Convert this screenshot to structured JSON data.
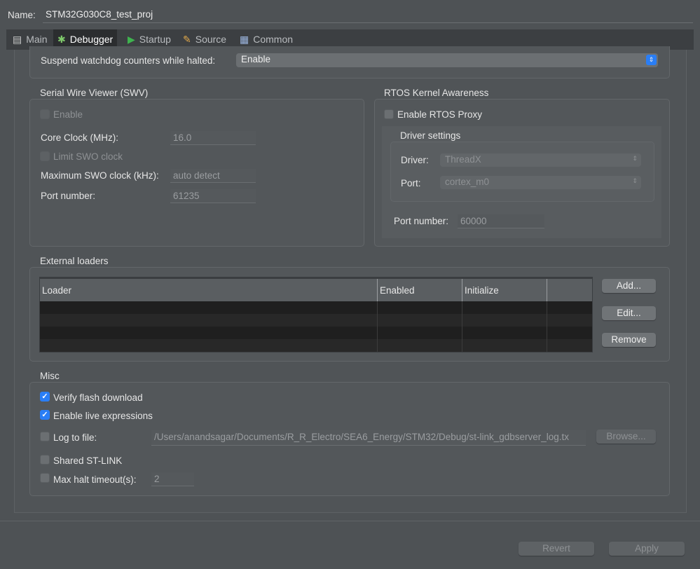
{
  "name_label": "Name:",
  "name_value": "STM32G030C8_test_proj",
  "tabs": [
    {
      "label": "Main",
      "icon": "document-icon"
    },
    {
      "label": "Debugger",
      "icon": "bug-icon"
    },
    {
      "label": "Startup",
      "icon": "play-icon"
    },
    {
      "label": "Source",
      "icon": "source-icon"
    },
    {
      "label": "Common",
      "icon": "table-icon"
    }
  ],
  "watchdog": {
    "label": "Suspend watchdog counters while halted:",
    "value": "Enable"
  },
  "swv": {
    "title": "Serial Wire Viewer (SWV)",
    "enable_label": "Enable",
    "enable_checked": false,
    "core_clock_label": "Core Clock (MHz):",
    "core_clock_value": "16.0",
    "limit_label": "Limit SWO clock",
    "limit_checked": false,
    "max_swo_label": "Maximum SWO clock (kHz):",
    "max_swo_value": "auto detect",
    "port_label": "Port number:",
    "port_value": "61235"
  },
  "rtos": {
    "title": "RTOS Kernel Awareness",
    "enable_label": "Enable RTOS Proxy",
    "enable_checked": false,
    "driver_settings_title": "Driver settings",
    "driver_label": "Driver:",
    "driver_value": "ThreadX",
    "port_label": "Port:",
    "port_value": "cortex_m0",
    "port_number_label": "Port number:",
    "port_number_value": "60000"
  },
  "external_loaders": {
    "title": "External loaders",
    "columns": [
      "Loader",
      "Enabled",
      "Initialize"
    ],
    "rows": [],
    "add_label": "Add...",
    "edit_label": "Edit...",
    "remove_label": "Remove"
  },
  "misc": {
    "title": "Misc",
    "verify_label": "Verify flash download",
    "verify_checked": true,
    "live_label": "Enable live expressions",
    "live_checked": true,
    "log_label": "Log to file:",
    "log_checked": false,
    "log_path": "/Users/anandsagar/Documents/R_R_Electro/SEA6_Energy/STM32/Debug/st-link_gdbserver_log.tx",
    "browse_label": "Browse...",
    "shared_label": "Shared ST-LINK",
    "shared_checked": false,
    "max_halt_label": "Max halt timeout(s):",
    "max_halt_checked": false,
    "max_halt_value": "2"
  },
  "footer": {
    "revert_label": "Revert",
    "apply_label": "Apply"
  },
  "colors": {
    "accent": "#2a7ef5",
    "tab_active": "#2b2d2f"
  }
}
